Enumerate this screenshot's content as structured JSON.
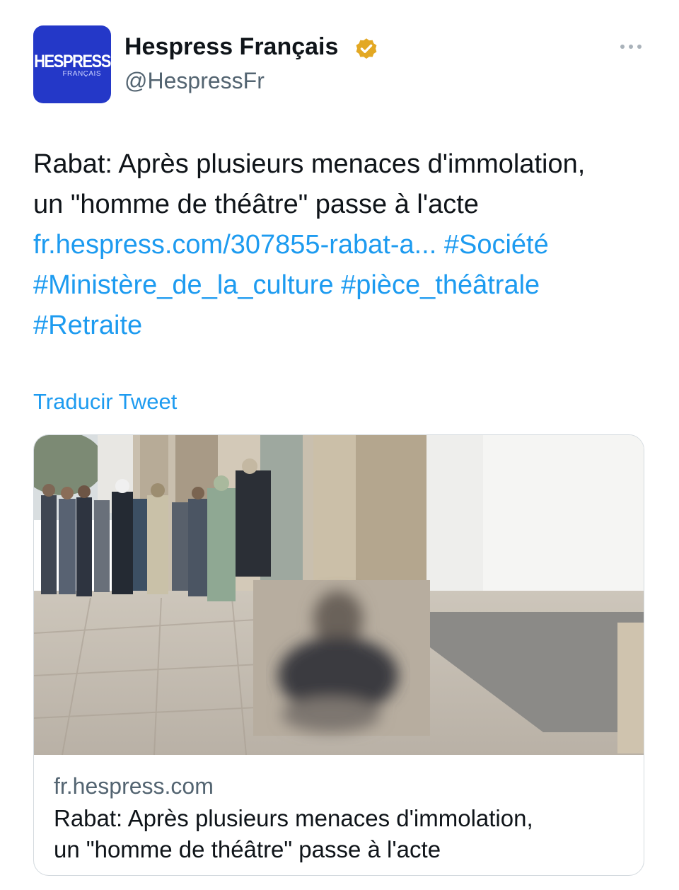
{
  "header": {
    "avatar": {
      "logo_main": "HESPRESS",
      "logo_sub": "FRANÇAIS",
      "color": "#2438c8"
    },
    "display_name": "Hespress Français",
    "handle": "@HespressFr",
    "verified_icon": "verified-badge-gold",
    "more_icon": "more-horizontal-icon"
  },
  "tweet": {
    "line1": "Rabat: Après plusieurs menaces d'immolation,",
    "line2": "un \"homme de théâtre\" passe à l'acte",
    "link": "fr.hespress.com/307855-rabat-a...",
    "hashtags": [
      "#Société",
      "#Ministère_de_la_culture",
      "#pièce_théâtrale",
      "#Retraite"
    ],
    "translate_label": "Traducir Tweet"
  },
  "card": {
    "image_description_icon": "news-photo",
    "domain": "fr.hespress.com",
    "title_line1": "Rabat: Après plusieurs menaces d'immolation,",
    "title_line2": "un \"homme de théâtre\" passe à l'acte"
  },
  "colors": {
    "link": "#1d9bf0",
    "text": "#0f1419",
    "secondary": "#536471",
    "badge": "#e3a823"
  }
}
